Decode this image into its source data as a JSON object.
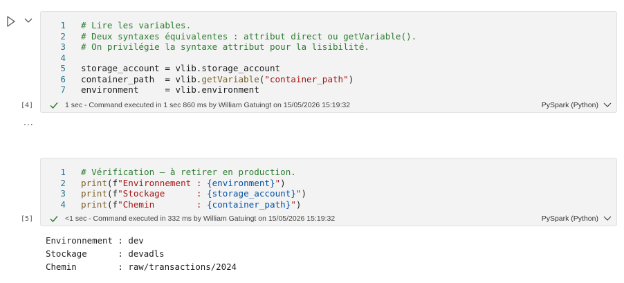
{
  "cells": [
    {
      "exec_count": "[4]",
      "lines": [
        {
          "n": "1",
          "parts": [
            {
              "t": "# Lire les variables.",
              "c": "c"
            }
          ]
        },
        {
          "n": "2",
          "parts": [
            {
              "t": "# Deux syntaxes équivalentes : attribut direct ou getVariable().",
              "c": "c"
            }
          ]
        },
        {
          "n": "3",
          "parts": [
            {
              "t": "# On privilégie la syntaxe attribut pour la lisibilité.",
              "c": "c"
            }
          ]
        },
        {
          "n": "4",
          "parts": []
        },
        {
          "n": "5",
          "parts": [
            {
              "t": "storage_account = vlib.storage_account",
              "c": ""
            }
          ]
        },
        {
          "n": "6",
          "parts": [
            {
              "t": "container_path  = vlib.",
              "c": ""
            },
            {
              "t": "getVariable",
              "c": "f"
            },
            {
              "t": "(",
              "c": ""
            },
            {
              "t": "\"container_path\"",
              "c": "s"
            },
            {
              "t": ")",
              "c": ""
            }
          ]
        },
        {
          "n": "7",
          "parts": [
            {
              "t": "environment     = vlib.environment",
              "c": ""
            }
          ]
        }
      ],
      "status": "1 sec - Command executed in 1 sec 860 ms by William Gatuingt on 15/05/2026 15:19:32",
      "language": "PySpark (Python)"
    },
    {
      "exec_count": "[5]",
      "lines": [
        {
          "n": "1",
          "parts": [
            {
              "t": "# Vérification — à retirer en production.",
              "c": "c"
            }
          ]
        },
        {
          "n": "2",
          "parts": [
            {
              "t": "print",
              "c": "f"
            },
            {
              "t": "(f",
              "c": ""
            },
            {
              "t": "\"Environnement : ",
              "c": "s"
            },
            {
              "t": "{environment}",
              "c": "v"
            },
            {
              "t": "\"",
              "c": "s"
            },
            {
              "t": ")",
              "c": ""
            }
          ]
        },
        {
          "n": "3",
          "parts": [
            {
              "t": "print",
              "c": "f"
            },
            {
              "t": "(f",
              "c": ""
            },
            {
              "t": "\"Stockage      : ",
              "c": "s"
            },
            {
              "t": "{storage_account}",
              "c": "v"
            },
            {
              "t": "\"",
              "c": "s"
            },
            {
              "t": ")",
              "c": ""
            }
          ]
        },
        {
          "n": "4",
          "parts": [
            {
              "t": "print",
              "c": "f"
            },
            {
              "t": "(f",
              "c": ""
            },
            {
              "t": "\"Chemin        : ",
              "c": "s"
            },
            {
              "t": "{container_path}",
              "c": "v"
            },
            {
              "t": "\"",
              "c": "s"
            },
            {
              "t": ")",
              "c": ""
            }
          ]
        }
      ],
      "status": "<1 sec - Command executed in 332 ms by William Gatuingt on 15/05/2026 15:19:32",
      "language": "PySpark (Python)"
    }
  ],
  "more_label": "...",
  "output": [
    "Environnement : dev",
    "Stockage      : devadls",
    "Chemin        : raw/transactions/2024"
  ],
  "colors": {
    "success": "#2e7d32",
    "cell_bg": "#f3f3f3"
  }
}
